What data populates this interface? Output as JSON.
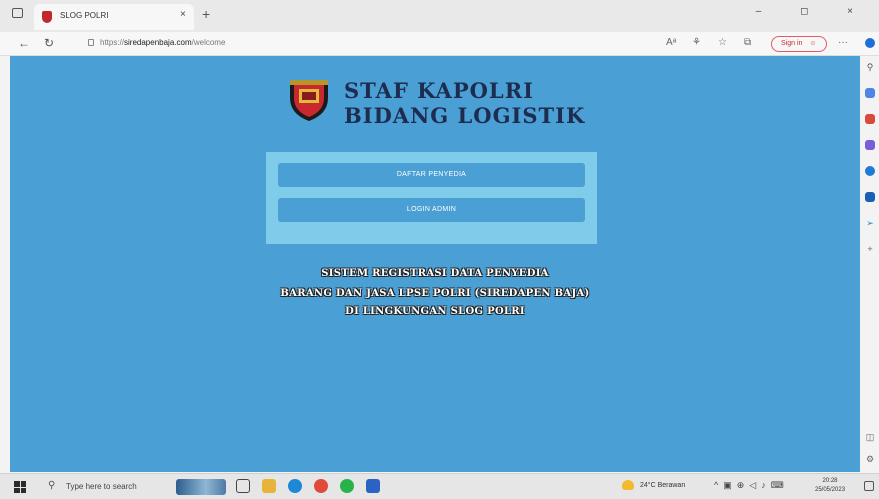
{
  "browser": {
    "tab_title": "SLOG POLRI",
    "tab_close": "×",
    "new_tab": "+",
    "window_controls": "–  ◻  ×",
    "url_prefix": "https://",
    "url_host": "siredapenbaja.com",
    "url_path": "/welcome",
    "sign_in_label": "Sign in"
  },
  "page": {
    "brand_line1": "STAF KAPOLRI",
    "brand_line2": "BIDANG LOGISTIK",
    "button_daftar": "DAFTAR PENYEDIA",
    "button_login": "LOGIN ADMIN",
    "info_line1": "SISTEM REGISTRASI DATA PENYEDIA",
    "info_line2": "BARANG DAN JASA LPSE POLRI (SIREDAPEN BAJA)",
    "info_line3": "DI LINGKUNGAN SLOG POLRI",
    "background_color": "#4a9fd4",
    "panel_color": "#7ecbea"
  },
  "taskbar": {
    "search_placeholder": "Type here to search",
    "weather": "24°C  Berawan",
    "time": "20:28",
    "date": "25/05/2023"
  }
}
